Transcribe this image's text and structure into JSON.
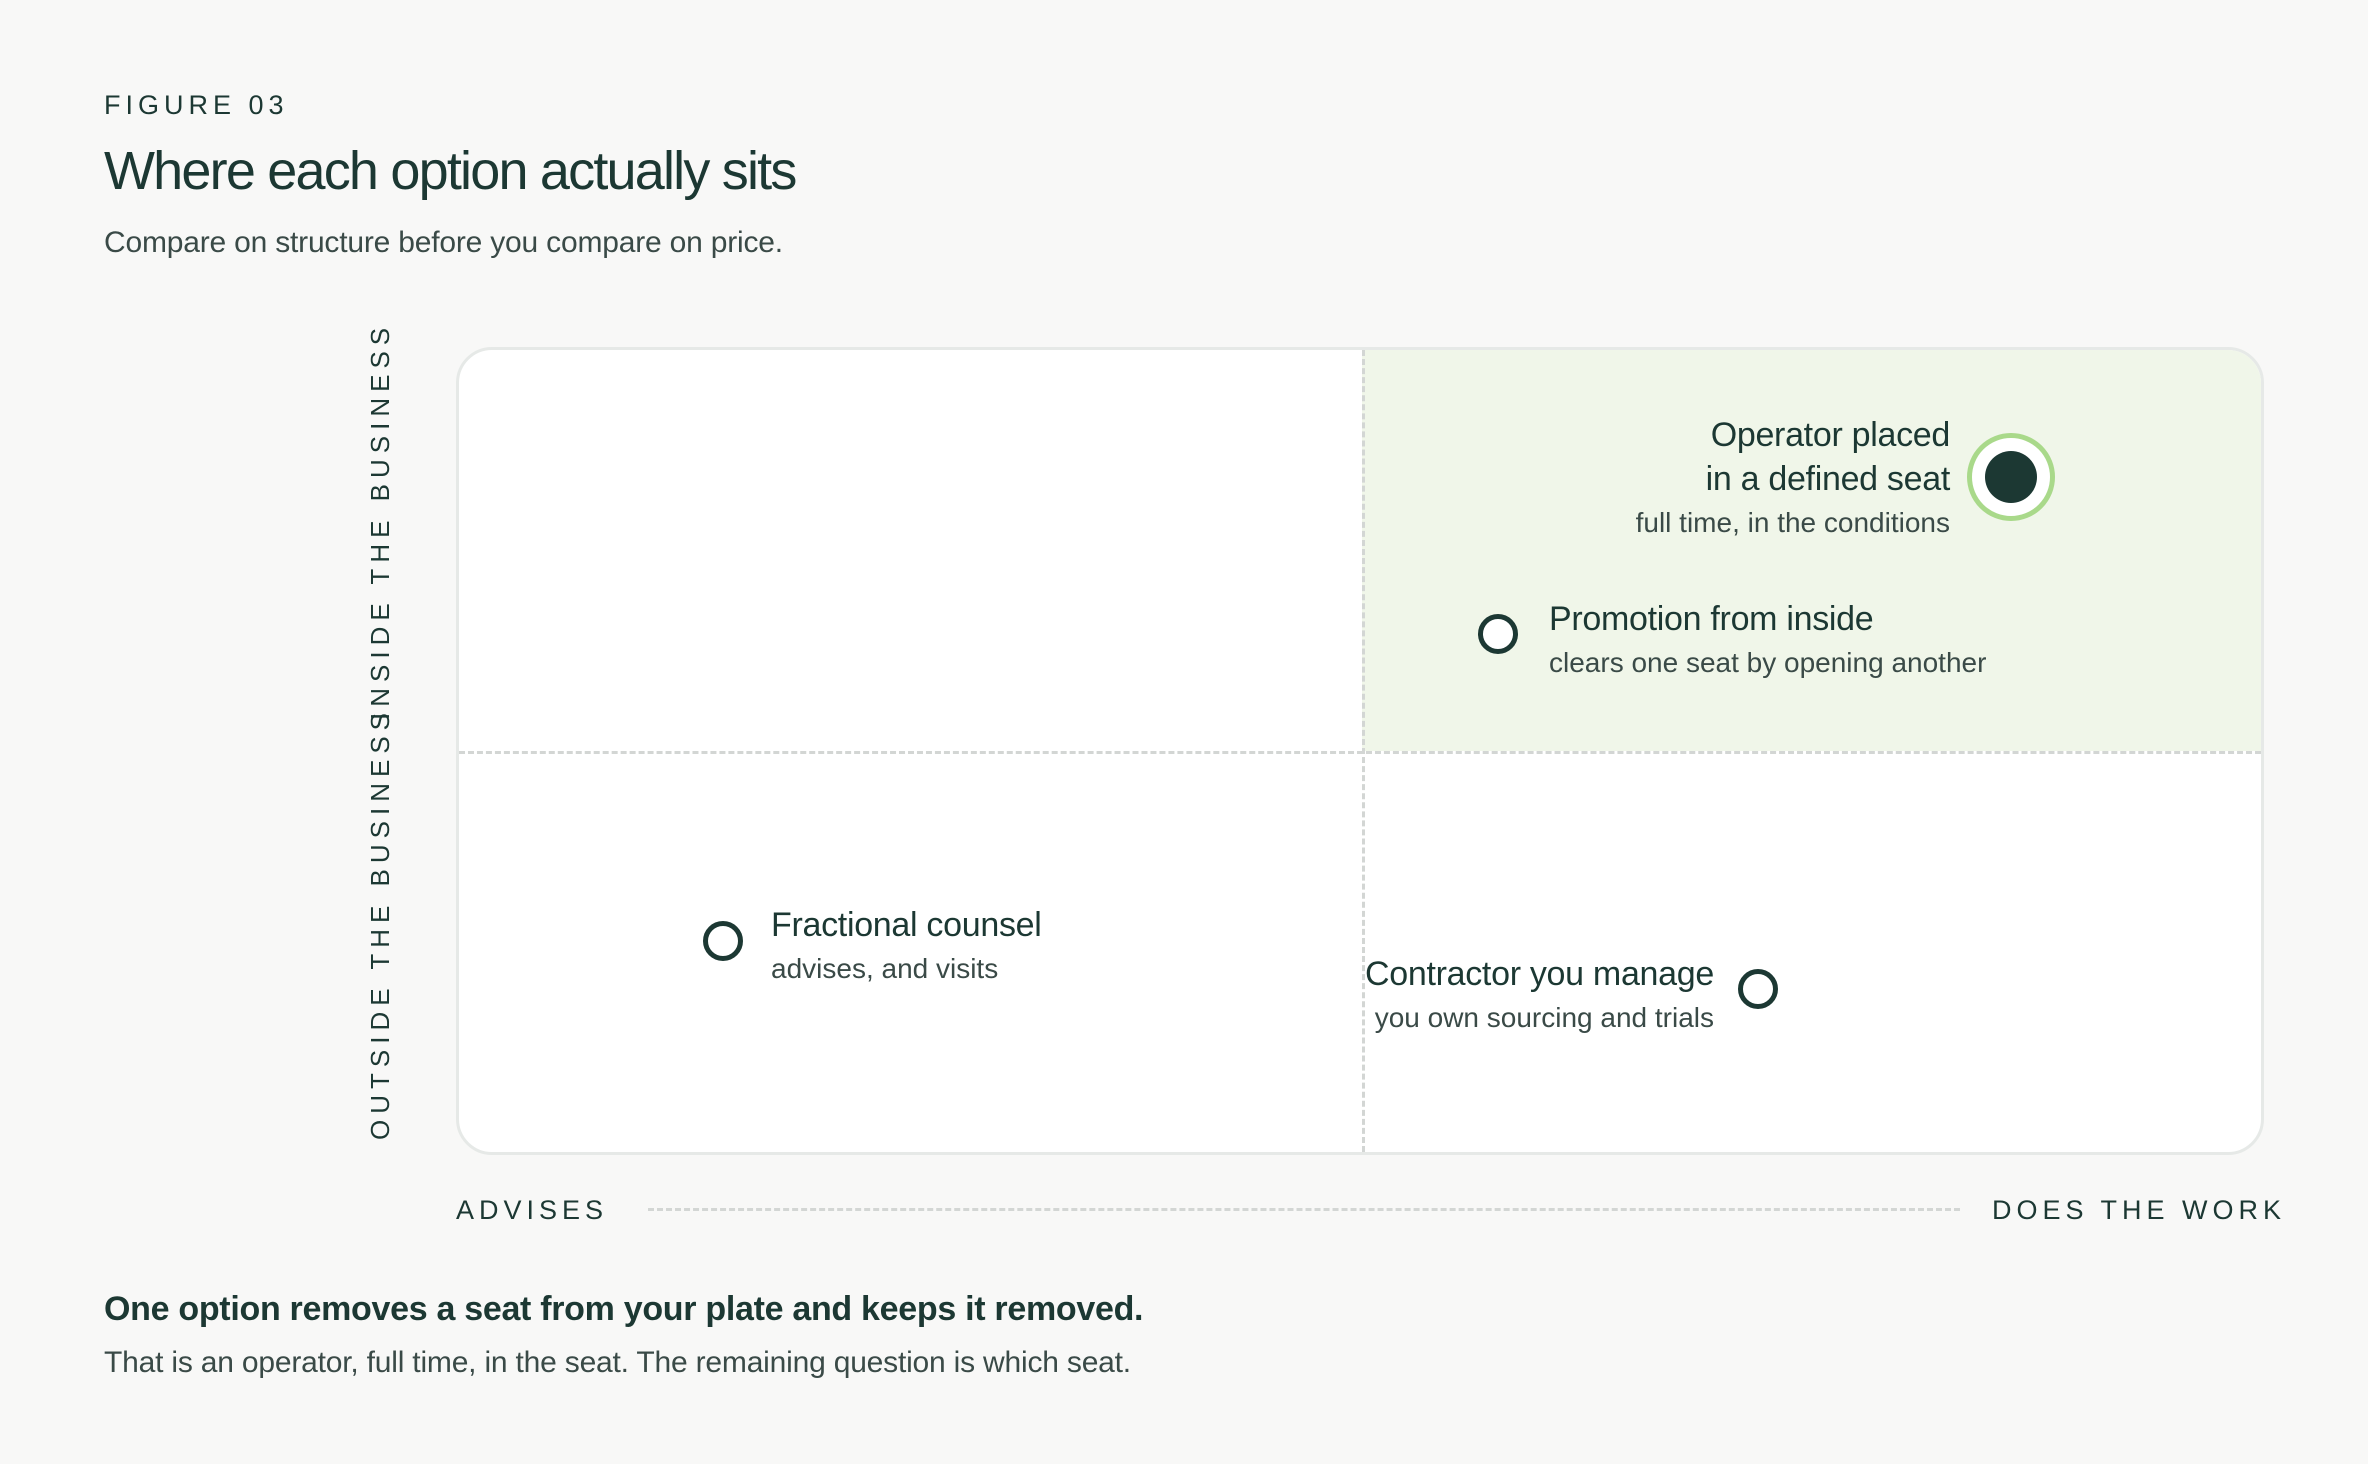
{
  "figure_label": "FIGURE 03",
  "title": "Where each option actually sits",
  "subtitle": "Compare on structure before you compare on price.",
  "axes": {
    "y_top": "INSIDE THE BUSINESS",
    "y_bottom": "OUTSIDE THE BUSINESS",
    "x_left": "ADVISES",
    "x_right": "DOES THE WORK"
  },
  "options": {
    "operator": {
      "title_line1": "Operator placed",
      "title_line2": "in a defined seat",
      "note": "full time, in the conditions"
    },
    "promotion": {
      "title": "Promotion from inside",
      "note": "clears one seat by opening another"
    },
    "fractional": {
      "title": "Fractional counsel",
      "note": "advises, and visits"
    },
    "contractor": {
      "title": "Contractor you manage",
      "note": "you own sourcing and trials"
    }
  },
  "conclusion": {
    "heading": "One option removes a seat from your plate and keeps it removed.",
    "body": "That is an operator, full time, in the seat. The remaining question is which seat."
  },
  "colors": {
    "ink": "#1c3833",
    "highlight_quadrant": "#f0f6e9",
    "highlight_ring": "#a9d98a"
  }
}
